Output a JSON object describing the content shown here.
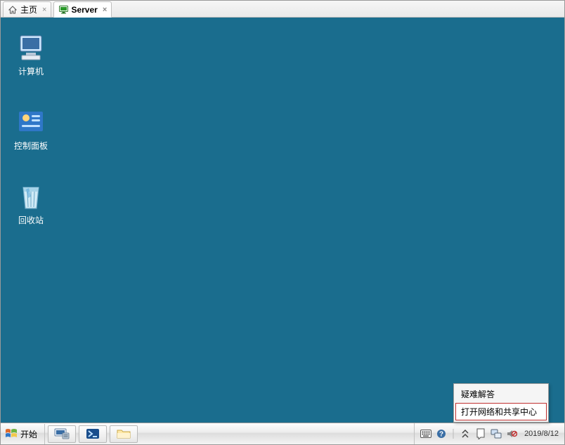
{
  "tabs": [
    {
      "label": "主页",
      "active": false
    },
    {
      "label": "Server",
      "active": true
    }
  ],
  "desktop_icons": {
    "computer": "计算机",
    "control_panel": "控制面板",
    "recycle_bin": "回收站"
  },
  "start_label": "开始",
  "context_menu": {
    "troubleshoot": "疑难解答",
    "open_network_center": "打开网络和共享中心"
  },
  "tray": {
    "date": "2019/8/12"
  }
}
